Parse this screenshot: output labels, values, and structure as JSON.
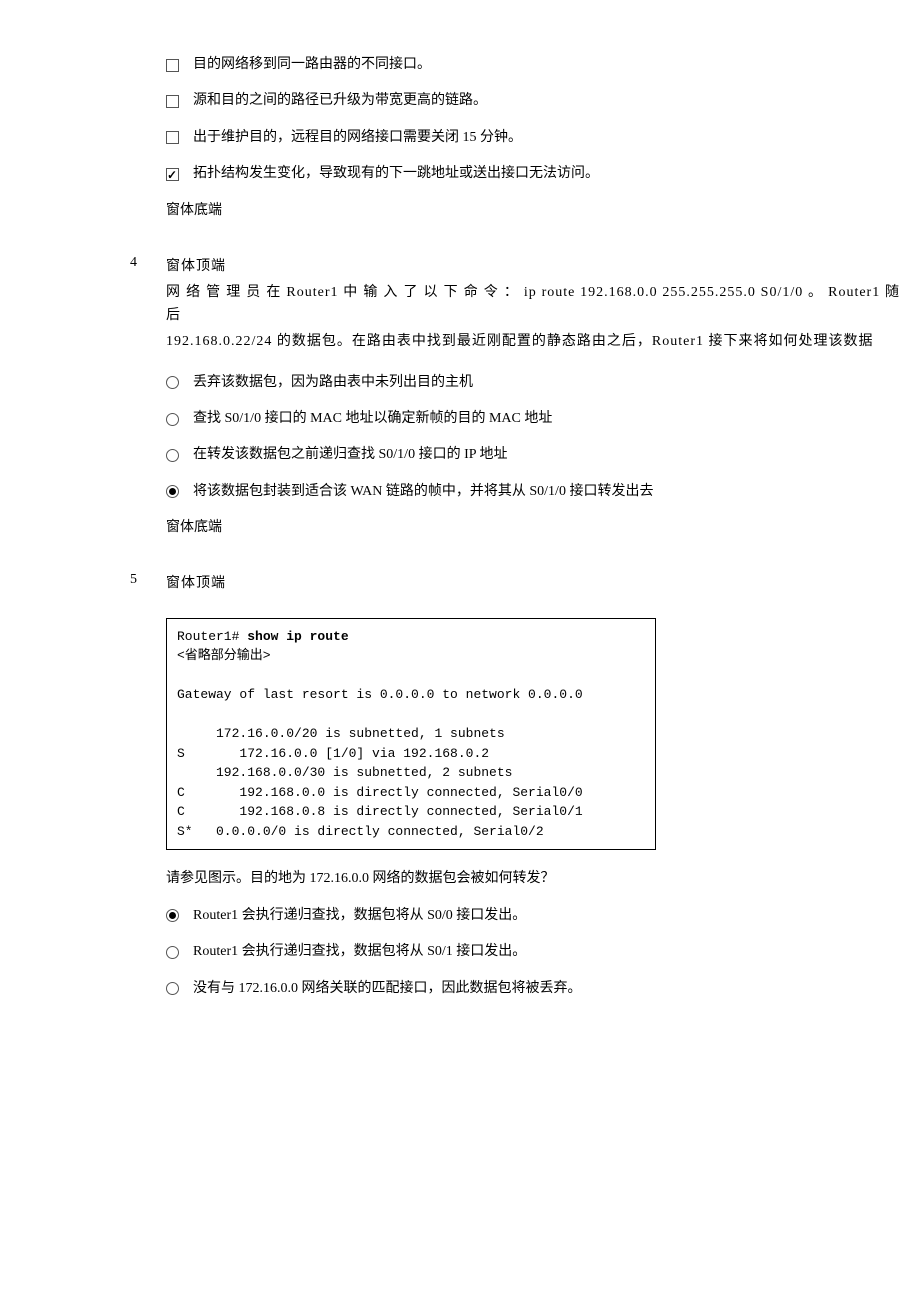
{
  "q3": {
    "options": [
      {
        "text": "目的网络移到同一路由器的不同接口。",
        "checked": false
      },
      {
        "text": "源和目的之间的路径已升级为带宽更高的链路。",
        "checked": false
      },
      {
        "text": "出于维护目的，远程目的网络接口需要关闭 15 分钟。",
        "checked": false
      },
      {
        "text": "拓扑结构发生变化，导致现有的下一跳地址或送出接口无法访问。",
        "checked": true
      }
    ],
    "footer": "窗体底端"
  },
  "q4": {
    "number": "4",
    "header": "窗体顶端",
    "para1": "网 络 管 理 员 在  Router1  中 输 入 了 以 下 命 令 ： ip route 192.168.0.0 255.255.255.0 S0/1/0 。 Router1  随 后",
    "para2": "192.168.0.22/24 的数据包。在路由表中找到最近刚配置的静态路由之后，Router1 接下来将如何处理该数据",
    "options": [
      {
        "text": "丢弃该数据包，因为路由表中未列出目的主机",
        "checked": false
      },
      {
        "text": "查找 S0/1/0 接口的 MAC 地址以确定新帧的目的 MAC 地址",
        "checked": false
      },
      {
        "text": "在转发该数据包之前递归查找 S0/1/0 接口的 IP 地址",
        "checked": false
      },
      {
        "text": "将该数据包封装到适合该 WAN 链路的帧中，并将其从 S0/1/0 接口转发出去",
        "checked": true
      }
    ],
    "footer": "窗体底端"
  },
  "q5": {
    "number": "5",
    "header": "窗体顶端",
    "code_prefix": "Router1# ",
    "code_cmd": "show ip route",
    "code_body": "\n<省略部分输出>\n\nGateway of last resort is 0.0.0.0 to network 0.0.0.0\n\n     172.16.0.0/20 is subnetted, 1 subnets\nS       172.16.0.0 [1/0] via 192.168.0.2\n     192.168.0.0/30 is subnetted, 2 subnets\nC       192.168.0.0 is directly connected, Serial0/0\nC       192.168.0.8 is directly connected, Serial0/1\nS*   0.0.0.0/0 is directly connected, Serial0/2",
    "question": "请参见图示。目的地为 172.16.0.0 网络的数据包会被如何转发？",
    "options": [
      {
        "text": "Router1 会执行递归查找，数据包将从 S0/0 接口发出。",
        "checked": true
      },
      {
        "text": "Router1 会执行递归查找，数据包将从 S0/1 接口发出。",
        "checked": false
      },
      {
        "text": "没有与 172.16.0.0 网络关联的匹配接口，因此数据包将被丢弃。",
        "checked": false
      }
    ]
  }
}
